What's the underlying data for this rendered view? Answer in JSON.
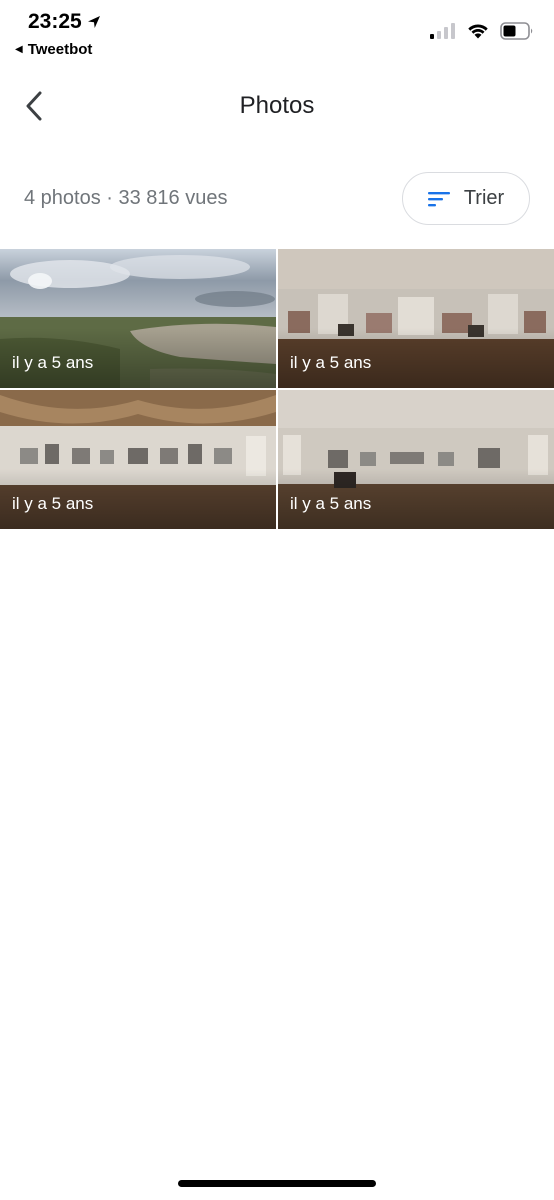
{
  "status_bar": {
    "time": "23:25",
    "back_app": "Tweetbot",
    "icons": [
      "location-arrow-icon",
      "signal-icon",
      "wifi-icon",
      "battery-icon"
    ]
  },
  "header": {
    "back_icon": "chevron-left-icon",
    "title": "Photos"
  },
  "summary": {
    "text": "4 photos · 33 816 vues"
  },
  "sort": {
    "label": "Trier",
    "icon": "sort-lines-icon",
    "accent": "#1a73e8"
  },
  "photos": [
    {
      "age": "il y a 5 ans",
      "scene": "landscape"
    },
    {
      "age": "il y a 5 ans",
      "scene": "gallery"
    },
    {
      "age": "il y a 5 ans",
      "scene": "gallery"
    },
    {
      "age": "il y a 5 ans",
      "scene": "gallery"
    }
  ]
}
